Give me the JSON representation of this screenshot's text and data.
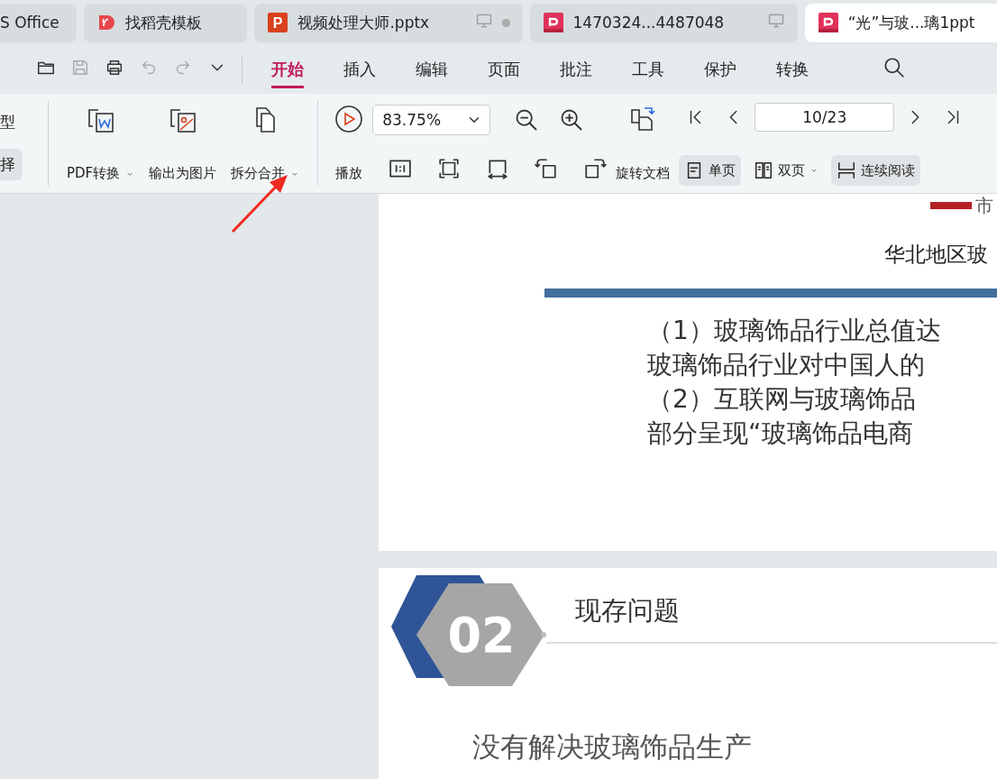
{
  "tabs": [
    {
      "kind": "plain",
      "title": "S Office",
      "selected": false,
      "device_icon": false,
      "unsaved": false
    },
    {
      "kind": "template",
      "title": "找稻壳模板",
      "selected": false,
      "device_icon": false,
      "unsaved": false
    },
    {
      "kind": "ppt",
      "icon_text": "P",
      "title": "视频处理大师.pptx",
      "selected": false,
      "device_icon": true,
      "unsaved": true
    },
    {
      "kind": "pdf",
      "title": "1470324...4487048",
      "selected": false,
      "device_icon": true,
      "unsaved": false
    },
    {
      "kind": "pdf",
      "title": "“光”与玻...璃1ppt",
      "selected": true,
      "device_icon": false,
      "unsaved": false
    }
  ],
  "quick_access": [
    {
      "kind": "folder",
      "disabled": false
    },
    {
      "kind": "save",
      "disabled": true
    },
    {
      "kind": "print",
      "disabled": false
    },
    {
      "kind": "undo",
      "disabled": true
    },
    {
      "kind": "redo",
      "disabled": true
    },
    {
      "kind": "more",
      "disabled": false
    }
  ],
  "menu_tabs": [
    {
      "label": "开始",
      "selected": true
    },
    {
      "label": "插入",
      "selected": false
    },
    {
      "label": "编辑",
      "selected": false
    },
    {
      "label": "页面",
      "selected": false
    },
    {
      "label": "批注",
      "selected": false
    },
    {
      "label": "工具",
      "selected": false
    },
    {
      "label": "保护",
      "selected": false
    },
    {
      "label": "转换",
      "selected": false
    }
  ],
  "ribbon": {
    "left_items": [
      {
        "label": "型",
        "selected": false
      },
      {
        "label": "择",
        "selected": true
      }
    ],
    "tools": [
      {
        "kind": "pdf-convert",
        "label": "PDF转换",
        "dropdown": true
      },
      {
        "kind": "export-image",
        "label": "输出为图片",
        "dropdown": false
      },
      {
        "kind": "split-merge",
        "label": "拆分合并",
        "dropdown": true
      }
    ],
    "play": {
      "label": "播放"
    },
    "zoom": {
      "value": "83.75%"
    },
    "rotate": {
      "label": "旋转文档"
    },
    "page": {
      "value": "10/23"
    },
    "view_modes": [
      {
        "kind": "single",
        "label": "单页",
        "selected": true,
        "dropdown": false
      },
      {
        "kind": "double",
        "label": "双页",
        "selected": false,
        "dropdown": true
      },
      {
        "kind": "continuous",
        "label": "连续阅读",
        "selected": true,
        "dropdown": false
      }
    ]
  },
  "slides": [
    {
      "kind": "text",
      "tag": "市",
      "heading": "华北地区玻",
      "lines": [
        "（1）玻璃饰品行业总值达",
        "玻璃饰品行业对中国人的",
        "（2）互联网与玻璃饰品",
        "部分呈现“玻璃饰品电商"
      ]
    },
    {
      "kind": "section",
      "number": "02",
      "title": "现存问题",
      "lines": [
        "没有解决玻璃饰品生产"
      ]
    }
  ]
}
